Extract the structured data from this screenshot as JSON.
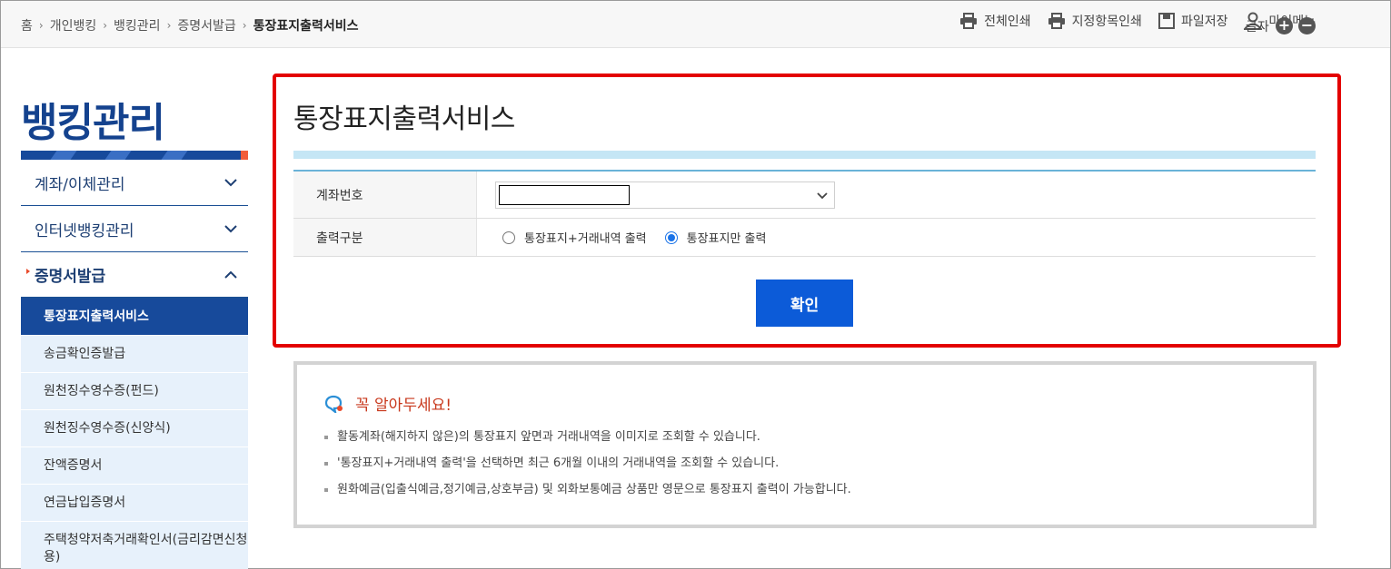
{
  "breadcrumb": {
    "home": "홈",
    "personal": "개인뱅킹",
    "banking_mgmt": "뱅킹관리",
    "cert": "증명서발급",
    "current": "통장표지출력서비스"
  },
  "tools": {
    "print_all": "전체인쇄",
    "print_selected": "지정항목인쇄",
    "save_file": "파일저장",
    "my_menu": "마이메뉴",
    "font_size": "글자",
    "font_plus": "+",
    "font_minus": "−"
  },
  "sidebar": {
    "title": "뱅킹관리",
    "menus": [
      {
        "label": "계좌/이체관리"
      },
      {
        "label": "인터넷뱅킹관리"
      },
      {
        "label": "증명서발급"
      }
    ],
    "sub_items": [
      {
        "label": "통장표지출력서비스"
      },
      {
        "label": "송금확인증발급"
      },
      {
        "label": "원천징수영수증(펀드)"
      },
      {
        "label": "원천징수영수증(신양식)"
      },
      {
        "label": "잔액증명서"
      },
      {
        "label": "연금납입증명서"
      },
      {
        "label": "주택청약저축거래확인서(금리감면신청용)"
      }
    ]
  },
  "main": {
    "title": "통장표지출력서비스",
    "form": {
      "account_label": "계좌번호",
      "account_value": "",
      "output_label": "출력구분",
      "option1": "통장표지+거래내역 출력",
      "option2": "통장표지만 출력",
      "selected_option": 2
    },
    "confirm_label": "확인"
  },
  "notice": {
    "title": "꼭 알아두세요!",
    "items": [
      "활동계좌(해지하지 않은)의 통장표지 앞면과 거래내역을 이미지로 조회할 수 있습니다.",
      "'통장표지+거래내역 출력'을 선택하면 최근 6개월 이내의 거래내역을 조회할 수 있습니다.",
      "원화예금(입출식예금,정기예금,상호부금) 및 외화보통예금 상품만 영문으로 통장표지 출력이 가능합니다."
    ]
  },
  "colors": {
    "brand_navy": "#174a9b",
    "highlight_border": "#e30000",
    "confirm_button": "#0c5bd8",
    "notice_title": "#c8381c"
  }
}
